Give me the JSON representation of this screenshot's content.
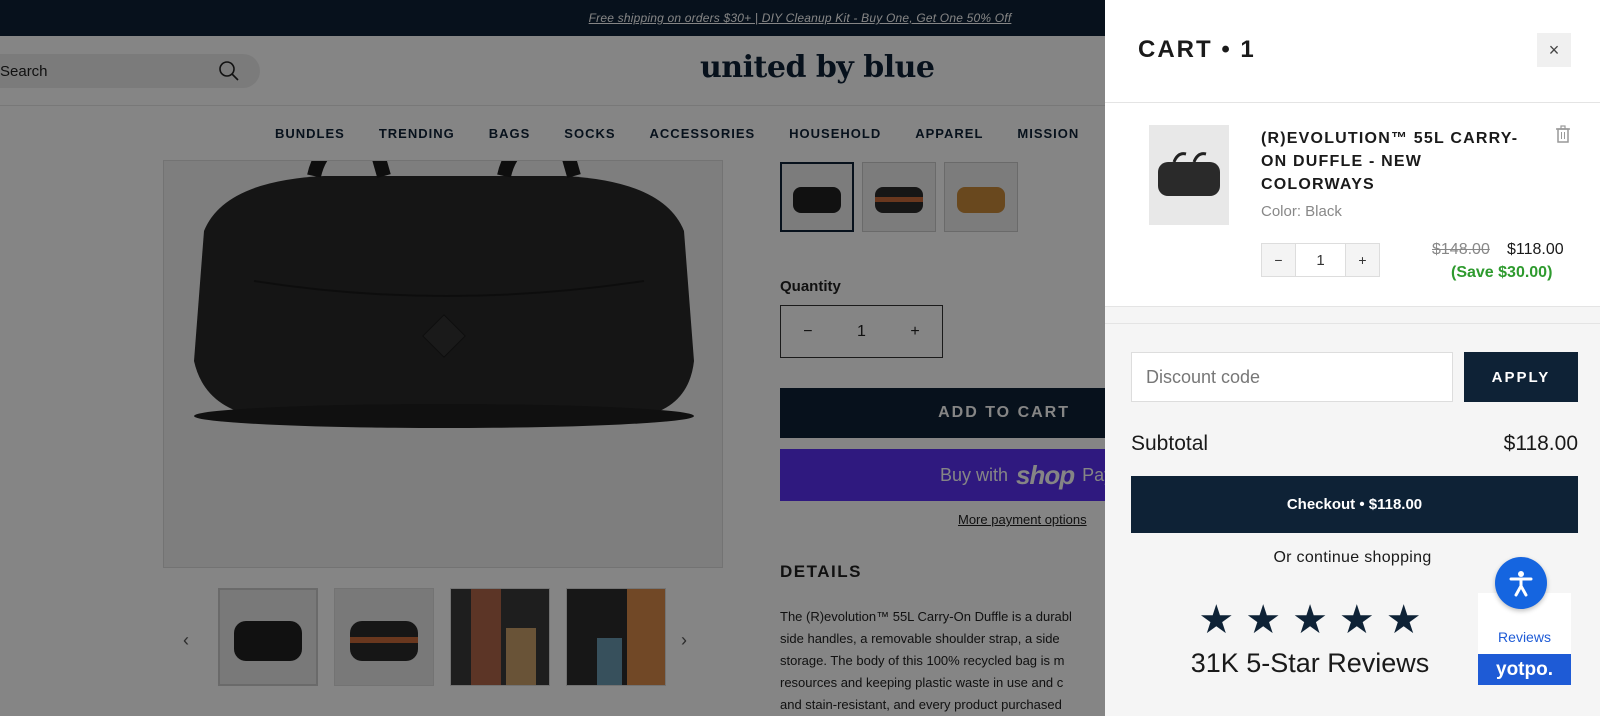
{
  "announcement": "Free shipping on orders $30+ | DIY Cleanup Kit - Buy One, Get One 50% Off",
  "header": {
    "search_label": "Search",
    "logo": "united by blue",
    "nav": [
      "BUNDLES",
      "TRENDING",
      "BAGS",
      "SOCKS",
      "ACCESSORIES",
      "HOUSEHOLD",
      "APPAREL",
      "MISSION"
    ]
  },
  "product": {
    "quantity_label": "Quantity",
    "quantity": "1",
    "add_to_cart": "ADD TO CART",
    "buy_with": "Buy with",
    "shop_word": "shop",
    "pay_word": "Pay",
    "more_payment": "More payment options",
    "details_heading": "DETAILS",
    "details_lines": [
      "The (R)evolution™ 55L Carry-On Duffle is a durabl",
      "side handles, a removable shoulder strap, a side",
      "storage. The body of this 100% recycled bag is m",
      "resources and keeping plastic waste in use and c",
      "and stain-resistant, and every product purchased"
    ]
  },
  "cart": {
    "title": "CART • 1",
    "item": {
      "name": "(R)EVOLUTION™ 55L CARRY-ON DUFFLE - NEW COLORWAYS",
      "color": "Color: Black",
      "quantity": "1",
      "price_old": "$148.00",
      "price_new": "$118.00",
      "savings": "(Save $30.00)"
    },
    "discount_placeholder": "Discount code",
    "apply_label": "APPLY",
    "subtotal_label": "Subtotal",
    "subtotal_value": "$118.00",
    "checkout_label": "Checkout • $118.00",
    "continue_label": "Or continue shopping",
    "reviews_label": "31K 5-Star Reviews",
    "yotpo_reviews": "Reviews",
    "yotpo_brand": "yotpo."
  },
  "colors": {
    "navy": "#0e2236",
    "shop_pay": "#5a31f4",
    "save_green": "#2e9a2e",
    "yotpo_blue": "#1e5bd6"
  }
}
